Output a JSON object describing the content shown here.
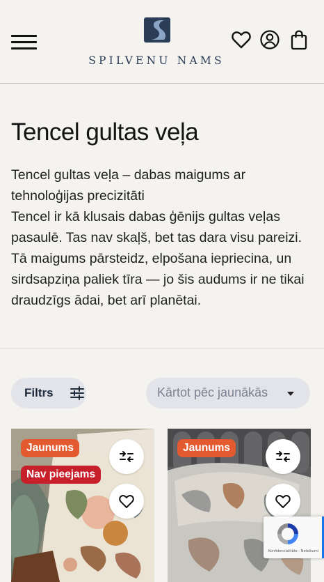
{
  "header": {
    "logo_text": "SPILVENU NAMS",
    "icons": [
      "menu-icon",
      "heart-icon",
      "user-icon",
      "bag-icon"
    ]
  },
  "page": {
    "title": "Tencel gultas veļa",
    "description": [
      "Tencel gultas veļa – dabas maigums ar tehnoloģijas precizitāti",
      "Tencel ir kā klusais dabas ģēnijs gultas veļas pasaulē. Tas nav skaļš, bet tas dara visu pareizi. Tā maigums pārsteidz, elpošana iepriecina, un sirdsapziņa paliek tīra — jo šis audums ir ne tikai draudzīgs ādai, bet arī planētai."
    ]
  },
  "toolbar": {
    "filter_label": "Filtrs",
    "sort_selected": "Kārtot pēc jaunākās"
  },
  "products": [
    {
      "badges": [
        "Jaunums",
        "Nav pieejams"
      ]
    },
    {
      "badges": [
        "Jaunums"
      ]
    }
  ],
  "recaptcha": {
    "text": "Konfidencialitāte - Noteikumi"
  },
  "colors": {
    "background": "#f4f3ef",
    "badge_new": "#e35a31",
    "badge_unavailable": "#c8202a",
    "pill": "#e2e4ea",
    "logo_navy": "#2a3a55"
  }
}
